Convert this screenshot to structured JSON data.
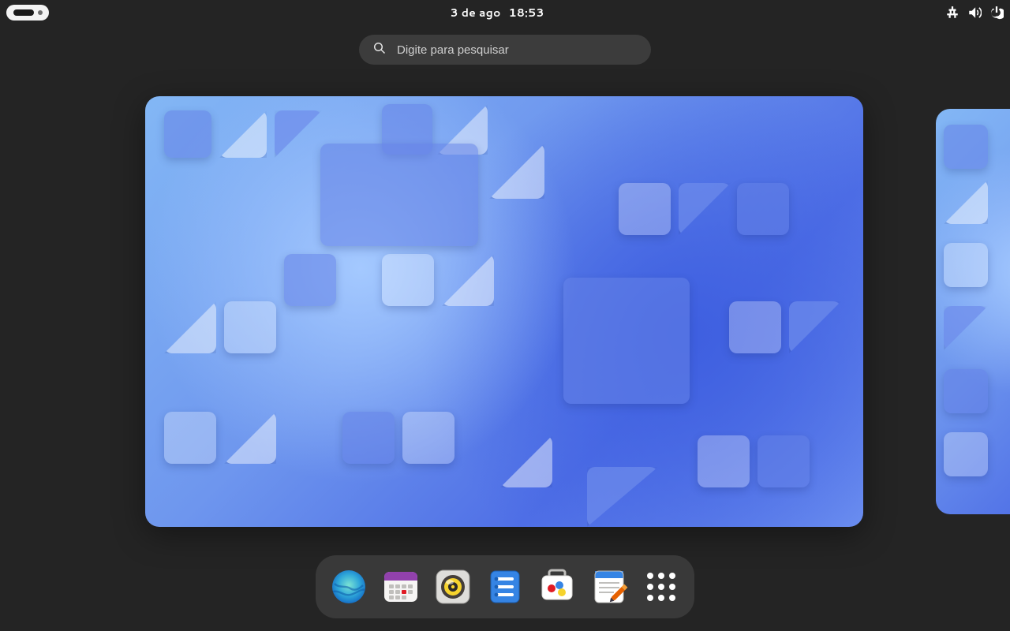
{
  "topbar": {
    "date": "3 de ago",
    "time": "18:53"
  },
  "search": {
    "placeholder": "Digite para pesquisar"
  },
  "dash": {
    "apps": [
      {
        "id": "web-browser",
        "name": "Web"
      },
      {
        "id": "calendar",
        "name": "Calendário"
      },
      {
        "id": "music",
        "name": "Rhythmbox"
      },
      {
        "id": "todo",
        "name": "Tarefas"
      },
      {
        "id": "software",
        "name": "Programas"
      },
      {
        "id": "text-editor",
        "name": "Editor de texto"
      }
    ],
    "show_apps_label": "Mostrar aplicativos"
  },
  "tray": {
    "icons": [
      "network-wired",
      "volume",
      "power"
    ]
  }
}
